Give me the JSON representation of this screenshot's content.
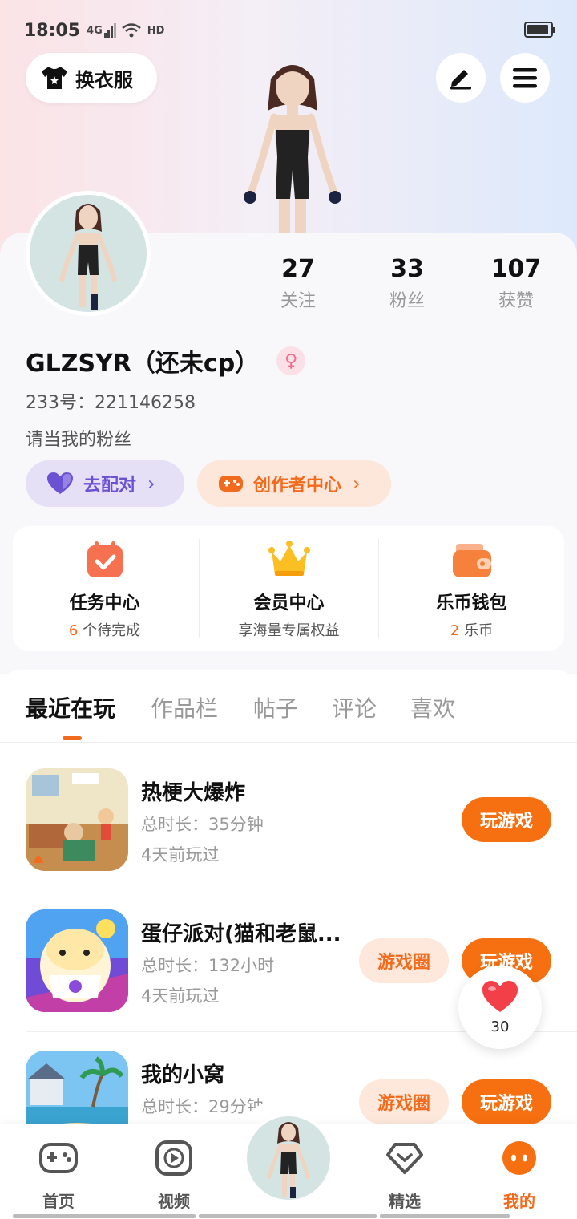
{
  "status_bar": {
    "time": "18:05",
    "signal": "4G",
    "hd": "HD"
  },
  "header": {
    "outfit_label": "换衣服",
    "edit_icon": "pen-icon",
    "menu_icon": "hamburger-icon"
  },
  "profile": {
    "stats": [
      {
        "num": "27",
        "label": "关注"
      },
      {
        "num": "33",
        "label": "粉丝"
      },
      {
        "num": "107",
        "label": "获赞"
      }
    ],
    "username": "GLZSYR（还未cp）",
    "gender_icon": "female-icon",
    "uid": "233号：221146258",
    "bio": "请当我的粉丝",
    "match_label": "去配对",
    "creator_label": "创作者中心"
  },
  "services": [
    {
      "title": "任务中心",
      "highlight": "6",
      "sub": " 个待完成"
    },
    {
      "title": "会员中心",
      "highlight": "",
      "sub": "享海量专属权益"
    },
    {
      "title": "乐币钱包",
      "highlight": "2",
      "sub": " 乐币"
    }
  ],
  "tabs": [
    "最近在玩",
    "作品栏",
    "帖子",
    "评论",
    "喜欢"
  ],
  "games": [
    {
      "name": "热梗大爆炸",
      "duration": "总时长：35分钟",
      "last": "4天前玩过",
      "play": "玩游戏",
      "circle": ""
    },
    {
      "name": "蛋仔派对(猫和老鼠...",
      "duration": "总时长：132小时",
      "last": "4天前玩过",
      "play": "玩游戏",
      "circle": "游戏圈"
    },
    {
      "name": "我的小窝",
      "duration": "总时长：29分钟",
      "last": "",
      "play": "玩游戏",
      "circle": "游戏圈"
    }
  ],
  "like_float": {
    "count": "30"
  },
  "nav": [
    {
      "label": "首页",
      "icon": "gamepad-icon"
    },
    {
      "label": "视频",
      "icon": "video-play-icon"
    },
    {
      "label": "精选",
      "icon": "heart-gem-icon"
    },
    {
      "label": "我的",
      "icon": "face-icon"
    }
  ],
  "colors": {
    "accent": "#f66f11",
    "purple": "#6a52d2"
  }
}
